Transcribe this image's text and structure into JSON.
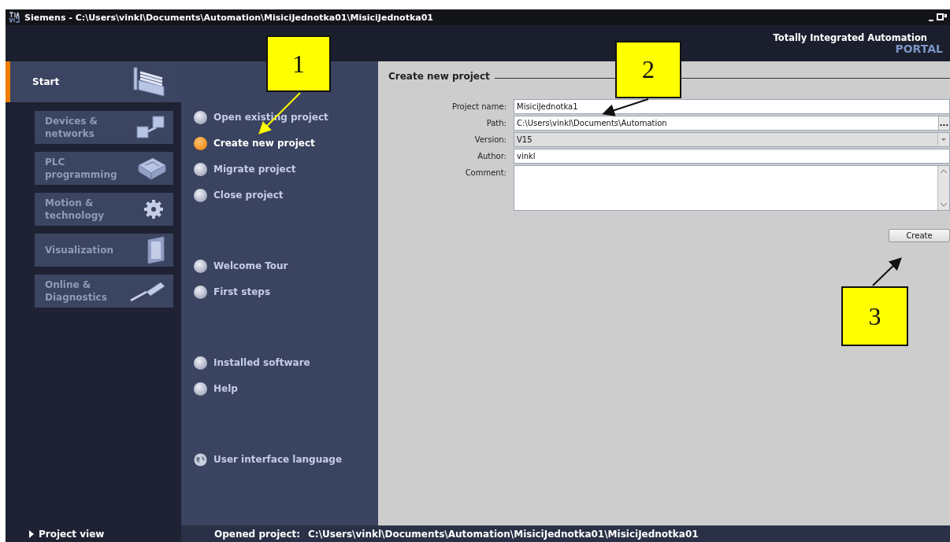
{
  "window": {
    "title": "Siemens  -  C:\\Users\\vinkl\\Documents\\Automation\\MisiciJednotka01\\MisiciJednotka01",
    "brand": "Totally Integrated Automation",
    "product": "PORTAL"
  },
  "sidebar": {
    "items": [
      {
        "label": "Start",
        "selected": true,
        "kind": "start"
      },
      {
        "label": "Devices &\nnetworks",
        "selected": false,
        "kind": "devices"
      },
      {
        "label": "PLC\nprogramming",
        "selected": false,
        "kind": "plc"
      },
      {
        "label": "Motion &\ntechnology",
        "selected": false,
        "kind": "motion"
      },
      {
        "label": "Visualization",
        "selected": false,
        "kind": "visualization"
      },
      {
        "label": "Online &\nDiagnostics",
        "selected": false,
        "kind": "online"
      }
    ],
    "footer": "Project view"
  },
  "actions": [
    [
      {
        "label": "Open existing project",
        "selected": false
      },
      {
        "label": "Create new project",
        "selected": true
      },
      {
        "label": "Migrate project",
        "selected": false
      },
      {
        "label": "Close project",
        "selected": false
      }
    ],
    [
      {
        "label": "Welcome Tour",
        "selected": false
      },
      {
        "label": "First steps",
        "selected": false
      }
    ],
    [
      {
        "label": "Installed software",
        "selected": false
      },
      {
        "label": "Help",
        "selected": false
      }
    ],
    [
      {
        "label": "User interface language",
        "selected": false,
        "kind": "language"
      }
    ]
  ],
  "form": {
    "title": "Create new project",
    "fields": [
      {
        "label": "Project name:",
        "value": "MisiciJednotka1",
        "kind": "text"
      },
      {
        "label": "Path:",
        "value": "C:\\Users\\vinkl\\Documents\\Automation",
        "kind": "browse",
        "button": "..."
      },
      {
        "label": "Version:",
        "value": "V15",
        "kind": "select"
      },
      {
        "label": "Author:",
        "value": "vinkl",
        "kind": "text"
      },
      {
        "label": "Comment:",
        "kind": "textarea"
      }
    ],
    "button": "Create"
  },
  "status_bar": {
    "label": "Opened project:",
    "value": "C:\\Users\\vinkl\\Documents\\Automation\\MisiciJednotka01\\MisiciJednotka01"
  },
  "callouts": [
    "1",
    "2",
    "3"
  ]
}
